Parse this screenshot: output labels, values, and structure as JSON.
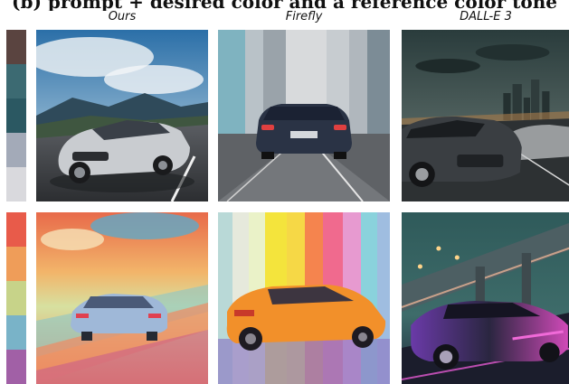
{
  "caption": "(b) prompt + desired color and a reference color tone",
  "columns": {
    "ours": "Ours",
    "firefly": "Firefly",
    "dalle": "DALL-E 3"
  },
  "palettes": {
    "row1": [
      "#5a4440",
      "#3c6a72",
      "#2b5862",
      "#a3aab8",
      "#d9d9dd"
    ],
    "row2": [
      "#e85b4a",
      "#ef9d59",
      "#c7d389",
      "#79b3c8",
      "#a160a6"
    ]
  }
}
